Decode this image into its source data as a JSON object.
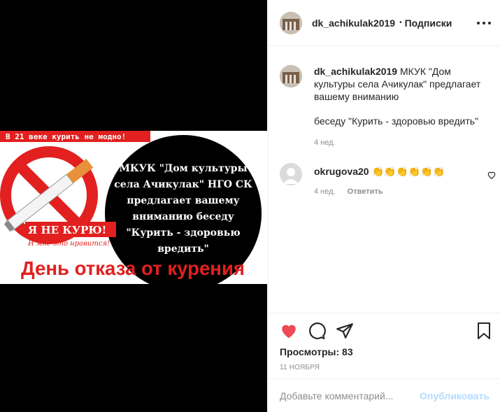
{
  "post": {
    "image": {
      "banner_top": "В 21 веке курить не модно!",
      "sticker": "Я НЕ КУРЮ!",
      "sticker_sub": "И мне это нравится!",
      "headline": "День отказа от курения",
      "circle_lines": [
        "МКУК \"Дом культуры",
        "села Ачикулак\" НГО СК",
        "предлагает вашему",
        "вниманию беседу",
        "\"Курить - здоровью",
        "вредить\""
      ]
    }
  },
  "header": {
    "username": "dk_achikulak2019",
    "separator": "•",
    "follow_label": "Подписки"
  },
  "caption": {
    "username": "dk_achikulak2019",
    "text": "МКУК \"Дом культуры села Ачикулак\" предлагает вашему вниманию",
    "text2": "беседу \"Курить - здоровью вредить\"",
    "time": "4 нед."
  },
  "comment": {
    "username": "okrugova20",
    "text": "👏👏👏👏👏👏",
    "time": "4 нед.",
    "reply_label": "Ответить"
  },
  "stats": {
    "views": "Просмотры: 83",
    "date": "11 НОЯБРЯ"
  },
  "add_comment": {
    "placeholder": "Добавьте комментарий...",
    "publish_label": "Опубликовать"
  }
}
